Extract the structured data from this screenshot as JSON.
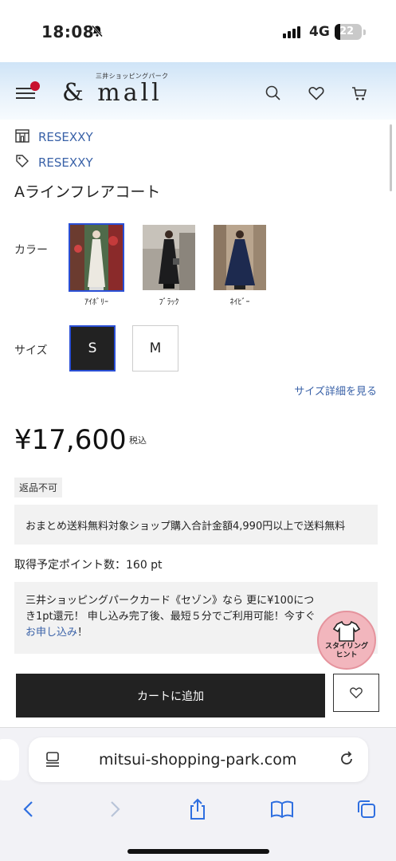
{
  "status_bar": {
    "time": "18:08",
    "network": "4G",
    "battery": "22"
  },
  "header": {
    "logo_sub": "三井ショッピングパーク",
    "logo_main": "& mall"
  },
  "shop": {
    "store_name": "RESEXXY",
    "brand_name": "RESEXXY"
  },
  "product": {
    "title": "Aラインフレアコート",
    "color_label": "カラー",
    "colors": [
      {
        "name": "ｱｲﾎﾞﾘｰ",
        "swatch": "#ece9e1"
      },
      {
        "name": "ﾌﾞﾗｯｸ",
        "swatch": "#1c1c1e"
      },
      {
        "name": "ﾈｲﾋﾞｰ",
        "swatch": "#1d2a4f"
      }
    ],
    "size_label": "サイズ",
    "sizes": [
      "S",
      "M"
    ],
    "size_detail_link": "サイズ詳細を見る",
    "price": "¥17,600",
    "tax_label": "税込",
    "badge": "返品不可",
    "shipping_note": "おまとめ送料無料対象ショップ購入合計金額4,990円以上で送料無料",
    "points": "取得予定ポイント数：160 pt",
    "card_promo_text": "三井ショッピングパークカード《セゾン》なら 更に¥100につき1pt還元！ 申し込み完了後、最短５分でご利用可能！今すぐ",
    "card_promo_link": "お申し込み",
    "card_promo_end": "！",
    "add_to_cart": "カートに追加"
  },
  "styling_hint": {
    "line1": "スタイリング",
    "line2": "ヒント"
  },
  "browser": {
    "url": "mitsui-shopping-park.com"
  },
  "colors": {
    "accent_link": "#3a62a8",
    "selected_border": "#2a4fd6",
    "menu_dot": "#c8102e",
    "styling_bg": "#f2b6bd"
  }
}
